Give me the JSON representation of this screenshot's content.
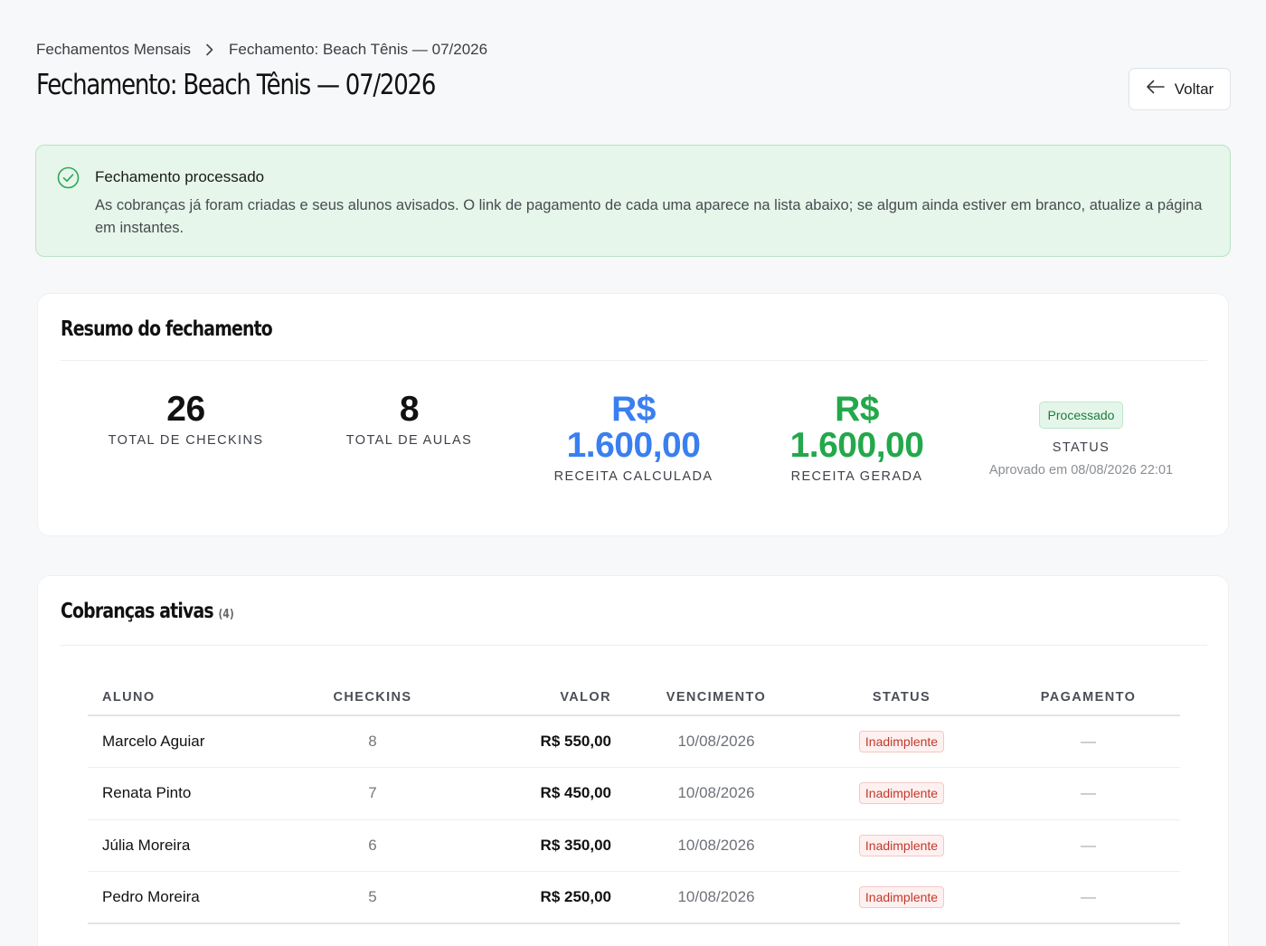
{
  "breadcrumb": {
    "parent": "Fechamentos Mensais",
    "current": "Fechamento: Beach Tênis — 07/2026"
  },
  "page": {
    "title": "Fechamento: Beach Tênis — 07/2026",
    "back_label": "Voltar"
  },
  "alert": {
    "title": "Fechamento processado",
    "text": "As cobranças já foram criadas e seus alunos avisados. O link de pagamento de cada uma aparece na lista abaixo; se algum ainda estiver em branco, atualize a página em instantes."
  },
  "summary": {
    "title": "Resumo do fechamento",
    "total_checkins": "26",
    "total_checkins_label": "TOTAL DE CHECKINS",
    "total_aulas": "8",
    "total_aulas_label": "TOTAL DE AULAS",
    "receita_calculada_currency": "R$",
    "receita_calculada": "1.600,00",
    "receita_calculada_label": "RECEITA CALCULADA",
    "receita_gerada_currency": "R$",
    "receita_gerada": "1.600,00",
    "receita_gerada_label": "RECEITA GERADA",
    "status_badge": "Processado",
    "status_label": "STATUS",
    "approved_text": "Aprovado em 08/08/2026 22:01"
  },
  "charges": {
    "title": "Cobranças ativas",
    "count": "(4)",
    "columns": [
      "ALUNO",
      "CHECKINS",
      "VALOR",
      "VENCIMENTO",
      "STATUS",
      "PAGAMENTO"
    ],
    "rows": [
      {
        "aluno": "Marcelo Aguiar",
        "checkins": "8",
        "valor": "R$ 550,00",
        "vencimento": "10/08/2026",
        "status": "Inadimplente",
        "pagamento": "—"
      },
      {
        "aluno": "Renata Pinto",
        "checkins": "7",
        "valor": "R$ 450,00",
        "vencimento": "10/08/2026",
        "status": "Inadimplente",
        "pagamento": "—"
      },
      {
        "aluno": "Júlia Moreira",
        "checkins": "6",
        "valor": "R$ 350,00",
        "vencimento": "10/08/2026",
        "status": "Inadimplente",
        "pagamento": "—"
      },
      {
        "aluno": "Pedro Moreira",
        "checkins": "5",
        "valor": "R$ 250,00",
        "vencimento": "10/08/2026",
        "status": "Inadimplente",
        "pagamento": "—"
      }
    ]
  },
  "colors": {
    "accent_blue": "#3a7ff0",
    "accent_green": "#23a84b",
    "danger": "#c0392b",
    "success_bg": "#e6f6ea"
  }
}
